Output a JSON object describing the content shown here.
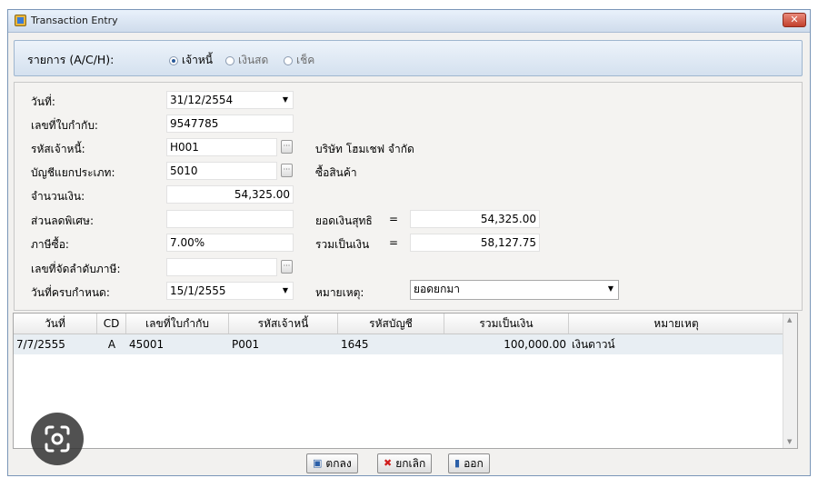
{
  "window": {
    "title": "Transaction Entry",
    "close_icon": "✕"
  },
  "type_bar": {
    "label": "รายการ (A/C/H):",
    "options": [
      {
        "label": "เจ้าหนี้",
        "checked": true
      },
      {
        "label": "เงินสด",
        "checked": false
      },
      {
        "label": "เช็ค",
        "checked": false
      }
    ]
  },
  "form": {
    "date_label": "วันที่:",
    "date_value": "31/12/2554",
    "tax_invoice_label": "เลขที่ใบกำกับ:",
    "tax_invoice_value": "9547785",
    "creditor_code_label": "รหัสเจ้าหนี้:",
    "creditor_code_value": "H001",
    "creditor_name": "บริษัท โฮมเชฟ จำกัด",
    "sub_account_label": "บัญชีแยกประเภท:",
    "sub_account_value": "5010",
    "sub_account_name": "ซื้อสินค้า",
    "amount_label": "จำนวนเงิน:",
    "amount_value": "54,325.00",
    "discount_label": "ส่วนลดพิเศษ:",
    "discount_value": "",
    "net_label": "ยอดเงินสุทธิ",
    "net_eq": "=",
    "net_value": "54,325.00",
    "vat_label": "ภาษีซื้อ:",
    "vat_value": "7.00%",
    "total_label": "รวมเป็นเงิน",
    "total_eq": "=",
    "total_value": "58,127.75",
    "tax_seq_label": "เลขที่จัดลำดับภาษี:",
    "tax_seq_value": "",
    "due_label": "วันที่ครบกำหนด:",
    "due_value": "15/1/2555",
    "note_label": "หมายเหตุ:",
    "note_value": "ยอดยกมา"
  },
  "grid": {
    "headers": [
      "วันที่",
      "CD",
      "เลขที่ใบกำกับ",
      "รหัสเจ้าหนี้",
      "รหัสบัญชี",
      "รวมเป็นเงิน",
      "หมายเหตุ"
    ],
    "rows": [
      [
        "7/7/2555",
        "A",
        "45001",
        "P001",
        "1645",
        "100,000.00",
        "เงินดาวน์"
      ]
    ]
  },
  "buttons": {
    "ok": "ตกลง",
    "cancel": "ยกเลิก",
    "exit": "ออก"
  }
}
